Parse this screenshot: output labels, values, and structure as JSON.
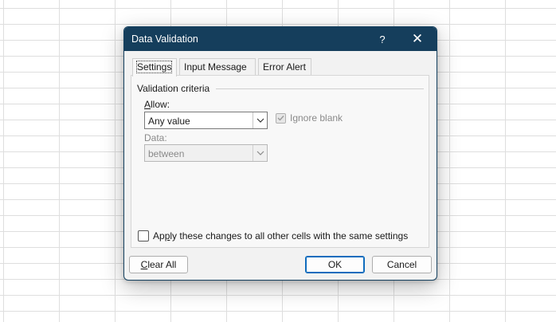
{
  "dialog": {
    "title": "Data Validation",
    "help_glyph": "?",
    "close_glyph": "✕"
  },
  "tabs": [
    {
      "label": "Settings",
      "active": true
    },
    {
      "label": "Input Message",
      "active": false
    },
    {
      "label": "Error Alert",
      "active": false
    }
  ],
  "criteria": {
    "group_label": "Validation criteria",
    "allow_label_pre": "",
    "allow_label_u": "A",
    "allow_label_post": "llow:",
    "allow_value": "Any value",
    "ignore_blank_label": "Ignore blank",
    "ignore_blank_checked": true,
    "data_label": "Data:",
    "data_value": "between"
  },
  "apply": {
    "label_pre": "Ap",
    "label_u": "p",
    "label_post": "ly these changes to all other cells with the same settings",
    "checked": false
  },
  "buttons": {
    "clear_pre": "",
    "clear_u": "C",
    "clear_post": "lear All",
    "ok": "OK",
    "cancel": "Cancel"
  },
  "icons": {
    "dropdown": "chevron-down-icon",
    "check": "check-icon"
  },
  "colors": {
    "titlebar": "#153e5c",
    "ok_border": "#0f6cbd"
  }
}
